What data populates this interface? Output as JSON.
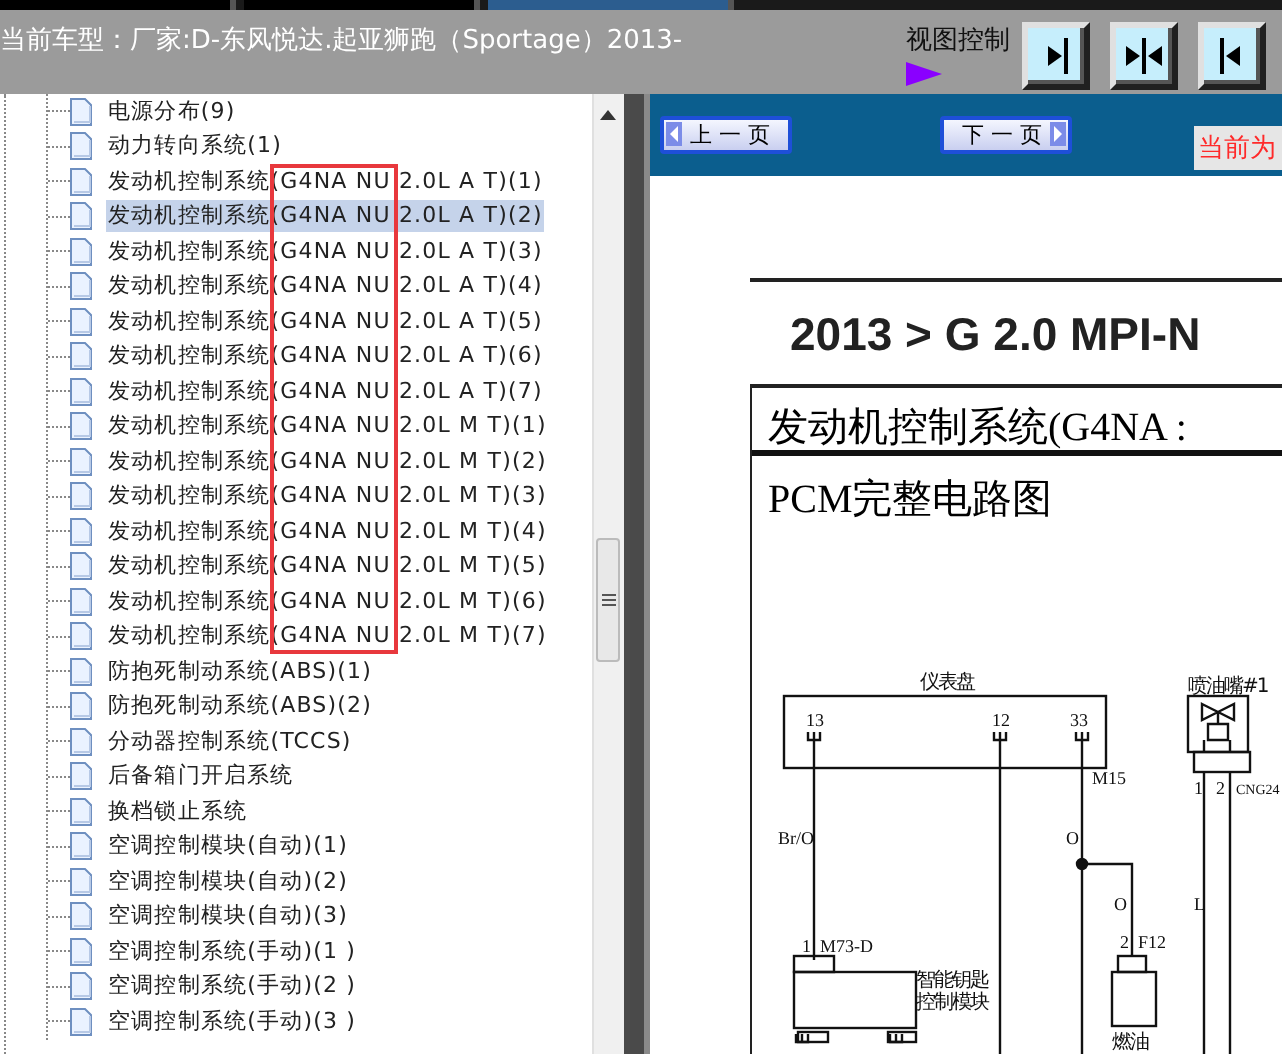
{
  "header": {
    "title": "当前车型：厂家:D-东风悦达.起亚狮跑（Sportage）2013-",
    "view_control_label": "视图控制"
  },
  "tree": {
    "items": [
      {
        "label": "电源分布(9)",
        "selected": false
      },
      {
        "label": "动力转向系统(1)",
        "selected": false
      },
      {
        "label": "发动机控制系统(G4NA NU 2.0L A T)(1)",
        "selected": false
      },
      {
        "label": "发动机控制系统(G4NA NU 2.0L A T)(2)",
        "selected": true
      },
      {
        "label": "发动机控制系统(G4NA NU 2.0L A T)(3)",
        "selected": false
      },
      {
        "label": "发动机控制系统(G4NA NU 2.0L A T)(4)",
        "selected": false
      },
      {
        "label": "发动机控制系统(G4NA NU 2.0L A T)(5)",
        "selected": false
      },
      {
        "label": "发动机控制系统(G4NA NU 2.0L A T)(6)",
        "selected": false
      },
      {
        "label": "发动机控制系统(G4NA NU 2.0L A T)(7)",
        "selected": false
      },
      {
        "label": "发动机控制系统(G4NA NU 2.0L M T)(1)",
        "selected": false
      },
      {
        "label": "发动机控制系统(G4NA NU 2.0L M T)(2)",
        "selected": false
      },
      {
        "label": "发动机控制系统(G4NA NU 2.0L M T)(3)",
        "selected": false
      },
      {
        "label": "发动机控制系统(G4NA NU 2.0L M T)(4)",
        "selected": false
      },
      {
        "label": "发动机控制系统(G4NA NU 2.0L M T)(5)",
        "selected": false
      },
      {
        "label": "发动机控制系统(G4NA NU 2.0L M T)(6)",
        "selected": false
      },
      {
        "label": "发动机控制系统(G4NA NU 2.0L M T)(7)",
        "selected": false
      },
      {
        "label": "防抱死制动系统(ABS)(1)",
        "selected": false
      },
      {
        "label": "防抱死制动系统(ABS)(2)",
        "selected": false
      },
      {
        "label": "分动器控制系统(TCCS)",
        "selected": false
      },
      {
        "label": "后备箱门开启系统",
        "selected": false
      },
      {
        "label": "换档锁止系统",
        "selected": false
      },
      {
        "label": "空调控制模块(自动)(1)",
        "selected": false
      },
      {
        "label": "空调控制模块(自动)(2)",
        "selected": false
      },
      {
        "label": "空调控制模块(自动)(3)",
        "selected": false
      },
      {
        "label": "空调控制系统(手动)(1 )",
        "selected": false
      },
      {
        "label": "空调控制系统(手动)(2 )",
        "selected": false
      },
      {
        "label": "空调控制系统(手动)(3 )",
        "selected": false
      }
    ],
    "annotation": {
      "color": "#e8383d"
    }
  },
  "toolbar": {
    "prev_button": "上 一 页",
    "next_button": "下 一 页",
    "current_label": "当前为"
  },
  "document": {
    "title": "2013 > G 2.0 MPI-N",
    "section": "发动机控制系统(G4NA :",
    "subtitle": "PCM完整电路图",
    "diagram_labels": [
      "仪表盘",
      "喷油嘴#1",
      "13",
      "12",
      "33",
      "M15",
      "1",
      "2",
      "CNG24",
      "Br/O",
      "O",
      "O",
      "L",
      "1",
      "M73-D",
      "2",
      "F12",
      "智能钥匙",
      "控制模块",
      "燃油"
    ]
  }
}
